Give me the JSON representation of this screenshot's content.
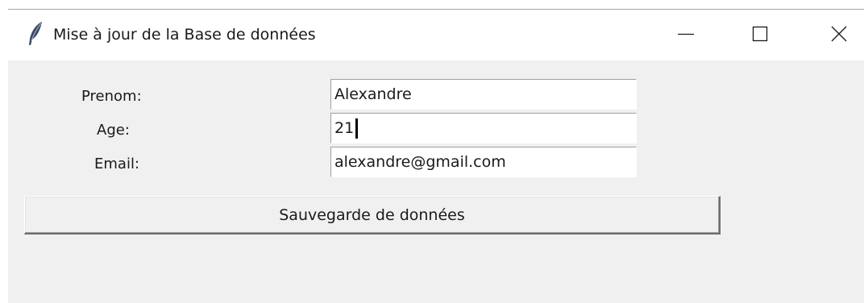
{
  "window": {
    "title": "Mise à jour de la Base de données",
    "icon": "feather-icon",
    "controls": {
      "minimize": "minimize-icon",
      "maximize": "maximize-icon",
      "close": "close-icon"
    }
  },
  "form": {
    "fields": [
      {
        "label": "Prenom:",
        "value": "Alexandre"
      },
      {
        "label": "Age:",
        "value": "21"
      },
      {
        "label": "Email:",
        "value": "alexandre@gmail.com"
      }
    ],
    "save_button_label": "Sauvegarde de données"
  },
  "colors": {
    "window_background": "#f0f0f0",
    "titlebar_background": "#ffffff",
    "text": "#1a1a1a"
  }
}
